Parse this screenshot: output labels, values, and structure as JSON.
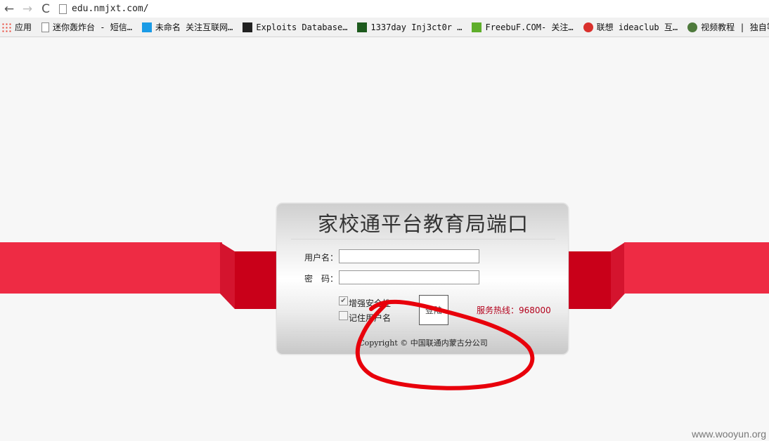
{
  "browser": {
    "url": "edu.nmjxt.com/",
    "back_icon": "←",
    "forward_icon": "→",
    "reload_icon": "C",
    "bookmarks": [
      {
        "label": "应用",
        "icon": "apps-grid-icon",
        "color": "#e94335"
      },
      {
        "label": "迷你轰炸台 - 短信…",
        "icon": "page-icon",
        "color": "#ffffff"
      },
      {
        "label": "未命名 关注互联网…",
        "icon": "mb-icon",
        "color": "#1a9be6"
      },
      {
        "label": "Exploits Database…",
        "icon": "exploit-db-icon",
        "color": "#222222"
      },
      {
        "label": "1337day Inj3ct0r …",
        "icon": "inj3ct0r-icon",
        "color": "#1d5a1d"
      },
      {
        "label": "FreebuF.COM- 关注…",
        "icon": "freebuf-icon",
        "color": "#5fae2b"
      },
      {
        "label": "联想 ideaclub 互…",
        "icon": "lenovo-icon",
        "color": "#d9302c"
      },
      {
        "label": "视频教程 | 独自等…",
        "icon": "avatar-icon",
        "color": "#4e7a3c"
      }
    ]
  },
  "login": {
    "title": "家校通平台教育局端口",
    "username_label": "用户名：",
    "password_label": "密　码：",
    "username_value": "",
    "password_value": "",
    "security_checkbox_label": "增强安全性",
    "security_checked": true,
    "remember_checkbox_label": "记住用户名",
    "remember_checked": false,
    "login_button": "登陆",
    "hotline": "服务热线：968000",
    "copyright": "Copyright © 中国联通内蒙古分公司"
  },
  "colors": {
    "ribbon": "#ee2b44",
    "ribbon_fold": "#c90019",
    "annotation": "#e8000b"
  },
  "watermark": "www.wooyun.org"
}
